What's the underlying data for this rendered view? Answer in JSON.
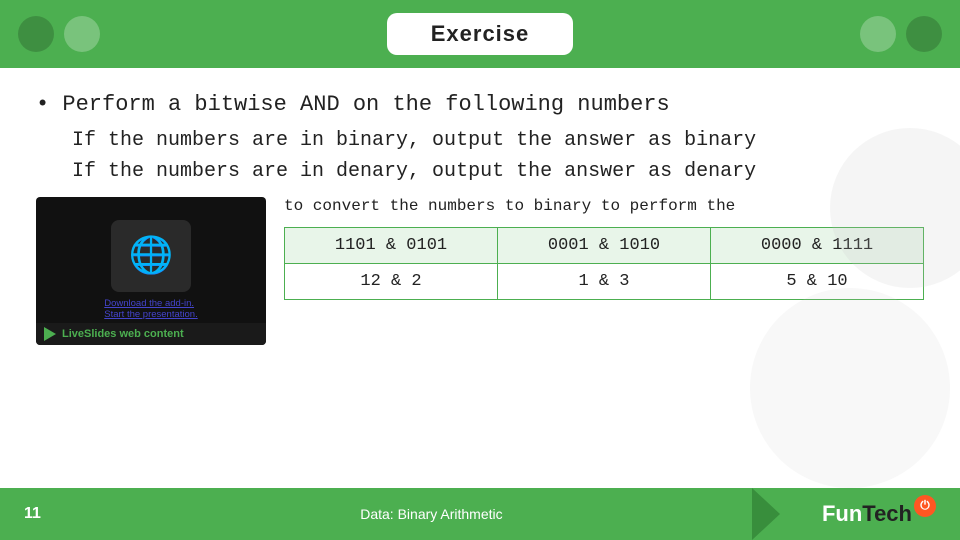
{
  "header": {
    "badge_label": "Exercise"
  },
  "main": {
    "bullet": "• Perform a bitwise AND on the following numbers",
    "indent1": "If the numbers are in binary, output the answer as binary",
    "indent2": "If the numbers are in denary, output the answer as denary",
    "convert_text": "to convert the numbers to binary to perform the",
    "table": {
      "rows": [
        [
          "1101 & 0101",
          "0001 & 1010",
          "0000 & 1111"
        ],
        [
          "12 & 2",
          "1 & 3",
          "5 & 10"
        ]
      ]
    }
  },
  "video": {
    "badge_text": "LiveSlides web content",
    "link1": "Download the add-in.",
    "link2": "Start the presentation."
  },
  "footer": {
    "slide_number": "11",
    "center_text": "Data: Binary Arithmetic",
    "logo_fun": "Fun",
    "logo_tech": "Tech",
    "logo_symbol": "⏻"
  }
}
